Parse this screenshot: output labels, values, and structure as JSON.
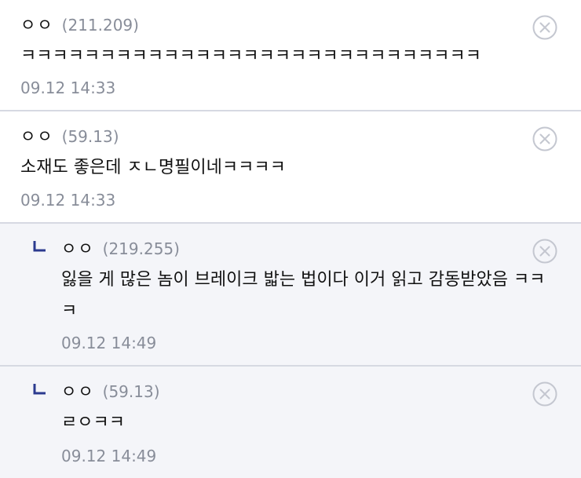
{
  "comments": [
    {
      "nick": "ㅇㅇ",
      "ip": "(211.209)",
      "text": "ㅋㅋㅋㅋㅋㅋㅋㅋㅋㅋㅋㅋㅋㅋㅋㅋㅋㅋㅋㅋㅋㅋㅋㅋㅋㅋㅋㅋㅋ",
      "date": "09.12 14:33"
    },
    {
      "nick": "ㅇㅇ",
      "ip": "(59.13)",
      "text": "소재도 좋은데 ㅈㄴ명필이네ㅋㅋㅋㅋ",
      "date": "09.12 14:33"
    },
    {
      "nick": "ㅇㅇ",
      "ip": "(219.255)",
      "text": "잃을 게 많은 놈이 브레이크 밟는 법이다 이거 읽고 감동받았음 ㅋㅋㅋ",
      "date": "09.12 14:49"
    },
    {
      "nick": "ㅇㅇ",
      "ip": "(59.13)",
      "text": "ㄹㅇㅋㅋ",
      "date": "09.12 14:49"
    }
  ],
  "icons": {
    "delete": "close-circle-icon",
    "reply": "reply-arrow-icon"
  },
  "colors": {
    "reply_background": "#f4f5f9",
    "meta_text": "#888d99",
    "divider": "#d6d9e2",
    "reply_icon": "#2b3a8f"
  }
}
